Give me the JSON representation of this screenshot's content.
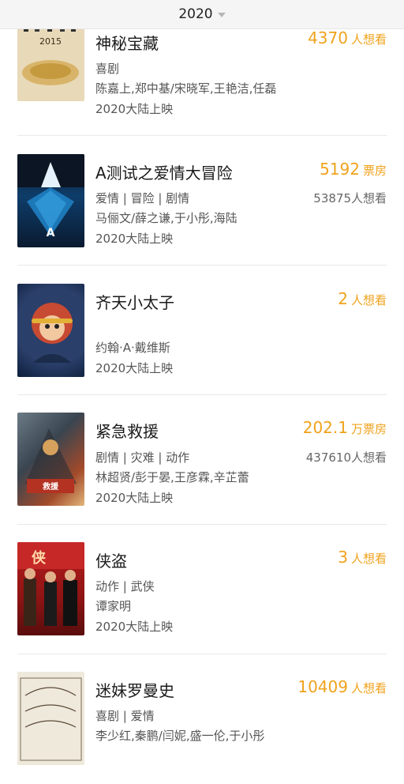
{
  "header": {
    "year": "2020"
  },
  "movies": [
    {
      "title": "神秘宝藏",
      "stat_num": "4370",
      "stat_unit": "人想看",
      "genres": "喜剧",
      "cast": "陈嘉上,郑中基/宋晓军,王艳洁,任磊",
      "release": "2020大陆上映",
      "want": ""
    },
    {
      "title": "A测试之爱情大冒险",
      "stat_num": "5192",
      "stat_unit": "票房",
      "genres": "爱情 | 冒险 | 剧情",
      "cast": "马俪文/薛之谦,于小彤,海陆",
      "release": "2020大陆上映",
      "want": "53875人想看"
    },
    {
      "title": "齐天小太子",
      "stat_num": "2",
      "stat_unit": "人想看",
      "genres": "",
      "cast": "约翰·A·戴维斯",
      "release": "2020大陆上映",
      "want": ""
    },
    {
      "title": "紧急救援",
      "stat_num": "202.1",
      "stat_unit": "万票房",
      "genres": "剧情 | 灾难 | 动作",
      "cast": "林超贤/彭于晏,王彦霖,辛芷蕾",
      "release": "2020大陆上映",
      "want": "437610人想看"
    },
    {
      "title": "侠盗",
      "stat_num": "3",
      "stat_unit": "人想看",
      "genres": "动作 | 武侠",
      "cast": "谭家明",
      "release": "2020大陆上映",
      "want": ""
    },
    {
      "title": "迷妹罗曼史",
      "stat_num": "10409",
      "stat_unit": "人想看",
      "genres": "喜剧 | 爱情",
      "cast": "李少红,秦鹏/闫妮,盛一伦,于小彤",
      "release": "",
      "want": ""
    }
  ],
  "colors": {
    "accent": "#f0a21c",
    "divider": "#e9e9e9",
    "header_bg": "#f5f5f5"
  }
}
